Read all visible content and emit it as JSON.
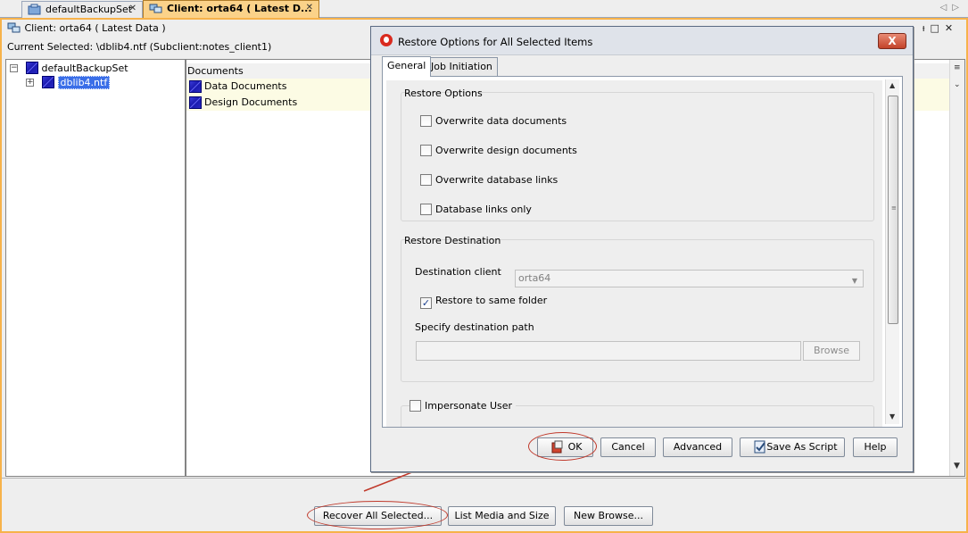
{
  "tabs": [
    {
      "label": "defaultBackupSet",
      "icon": "backupset-icon",
      "active": false
    },
    {
      "label": "Client: orta64 ( Latest D...",
      "icon": "client-icon",
      "active": true
    }
  ],
  "header": {
    "client_label": "Client: orta64 ( Latest Data )",
    "current_selected": "Current Selected: \\dblib4.ntf (Subclient:notes_client1)"
  },
  "tree": {
    "root": "defaultBackupSet",
    "child": "dblib4.ntf"
  },
  "list": {
    "header": "Documents",
    "rows": [
      "Data Documents",
      "Design Documents"
    ]
  },
  "bottom_buttons": {
    "recover": "Recover All Selected...",
    "list_media": "List Media and Size",
    "new_browse": "New Browse..."
  },
  "dialog": {
    "title": "Restore Options for All Selected Items",
    "close": "X",
    "tabs": [
      "General",
      "Job Initiation"
    ],
    "restore_options": {
      "title": "Restore Options",
      "items": [
        {
          "label": "Overwrite data documents",
          "checked": false
        },
        {
          "label": "Overwrite design documents",
          "checked": false
        },
        {
          "label": "Overwrite database links",
          "checked": false
        },
        {
          "label": "Database links only",
          "checked": false
        }
      ]
    },
    "restore_destination": {
      "title": "Restore Destination",
      "dest_client_label": "Destination client",
      "dest_client_value": "orta64",
      "same_folder_label": "Restore to same folder",
      "same_folder_checked": true,
      "dest_path_label": "Specify destination path",
      "dest_path_value": "",
      "browse": "Browse"
    },
    "impersonate": {
      "label": "Impersonate User",
      "checked": false
    },
    "buttons": {
      "ok": "OK",
      "cancel": "Cancel",
      "advanced": "Advanced",
      "save_script": "Save As Script",
      "help": "Help"
    }
  },
  "colors": {
    "tab_active": "#fbd289",
    "frame": "#f7b24a",
    "annotation": "#c0392b",
    "selection": "#3a6ee8"
  }
}
